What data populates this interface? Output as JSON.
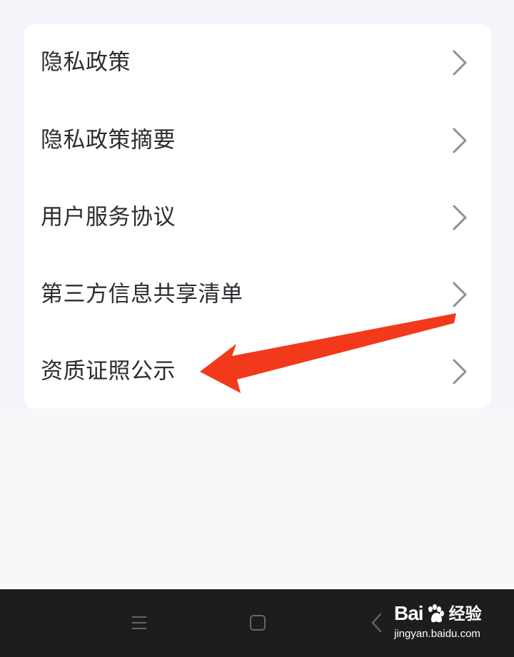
{
  "menu": {
    "items": [
      {
        "label": "隐私政策",
        "icon": "chevron-right-icon"
      },
      {
        "label": "隐私政策摘要",
        "icon": "chevron-right-icon"
      },
      {
        "label": "用户服务协议",
        "icon": "chevron-right-icon"
      },
      {
        "label": "第三方信息共享清单",
        "icon": "chevron-right-icon"
      },
      {
        "label": "资质证照公示",
        "icon": "chevron-right-icon"
      }
    ]
  },
  "annotation": {
    "icon": "red-arrow-pointer",
    "color": "#f2391c"
  },
  "navigation_bar": {
    "buttons": [
      {
        "icon": "menu-icon"
      },
      {
        "icon": "home-square-icon"
      },
      {
        "icon": "back-chevron-icon"
      }
    ]
  },
  "watermark": {
    "brand_text": "Bai",
    "brand_icon": "paw-icon",
    "brand_cn": "经验",
    "url": "jingyan.baidu.com"
  },
  "colors": {
    "card": "#ffffff",
    "page_background": "#f4f5fb",
    "text": "#2c2c32",
    "chevron": "#8f9098",
    "nav_background": "#1d1d1f"
  }
}
